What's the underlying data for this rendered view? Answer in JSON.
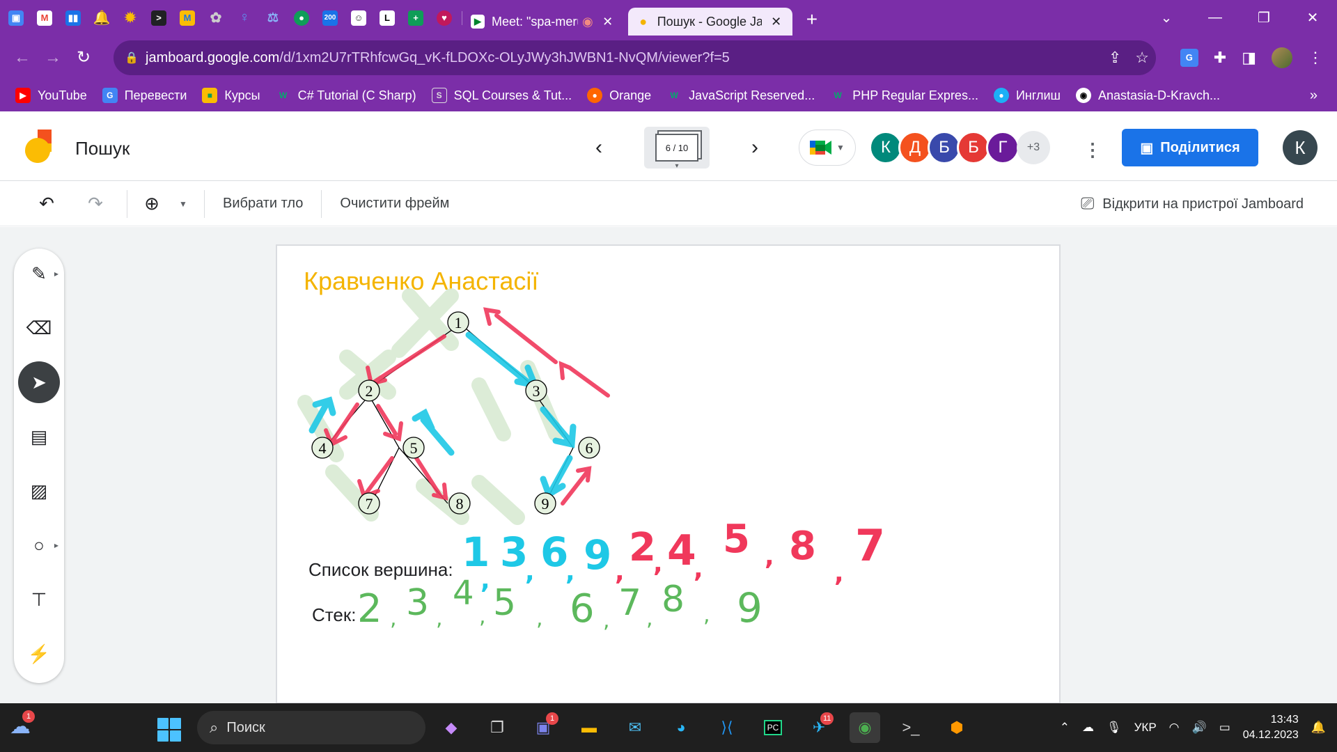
{
  "browser": {
    "tabs": [
      {
        "title": "Meet: \"spa-meru-u",
        "active": false
      },
      {
        "title": "Пошук - Google Jamboard",
        "active": true
      }
    ],
    "pinned_count": 16,
    "url_host": "jamboard.google.com",
    "url_path": "/d/1xm2U7rTRhfcwGq_vK-fLDOXc-OLyJWy3hJWBN1-NvQM/viewer?f=5",
    "bookmarks": [
      {
        "label": "YouTube",
        "icon": "youtube-icon",
        "color": "#ff0000"
      },
      {
        "label": "Перевести",
        "icon": "translate-icon",
        "color": "#4285f4"
      },
      {
        "label": "Курсы",
        "icon": "classroom-icon",
        "color": "#fbbc04"
      },
      {
        "label": "C# Tutorial (C Sharp)",
        "icon": "w3-icon",
        "color": "#04aa6d"
      },
      {
        "label": "SQL Courses & Tut...",
        "icon": "page-icon",
        "color": "#5f6368"
      },
      {
        "label": "Orange",
        "icon": "orange-icon",
        "color": "#ff6600"
      },
      {
        "label": "JavaScript Reserved...",
        "icon": "w3-icon",
        "color": "#04aa6d"
      },
      {
        "label": "PHP Regular Expres...",
        "icon": "w3-icon",
        "color": "#04aa6d"
      },
      {
        "label": "Инглиш",
        "icon": "duo-icon",
        "color": "#1cb0f6"
      },
      {
        "label": "Anastasia-D-Kravch...",
        "icon": "github-icon",
        "color": "#000000"
      }
    ],
    "bookmarks_more": "»"
  },
  "jamboard": {
    "title": "Пошук",
    "frame_indicator": "6 / 10",
    "collaborators": [
      {
        "initial": "К",
        "color": "#00897b"
      },
      {
        "initial": "Д",
        "color": "#f4511e"
      },
      {
        "initial": "Б",
        "color": "#3949ab"
      },
      {
        "initial": "Б",
        "color": "#e53935"
      },
      {
        "initial": "Г",
        "color": "#6a1b9a"
      }
    ],
    "collaborators_more": "+3",
    "share_label": "Поділитися",
    "user_initial": "К",
    "toolbar": {
      "background_label": "Вибрати тло",
      "clear_label": "Очистити фрейм",
      "open_device_label": "Відкрити на пристрої Jamboard"
    }
  },
  "frame": {
    "title": "Кравченко Анастасії",
    "title_color": "#f4b400",
    "list_label": "Список вершина:",
    "stack_label": "Стек:",
    "tree_nodes": [
      "1",
      "2",
      "3",
      "4",
      "5",
      "6",
      "7",
      "8",
      "9"
    ],
    "handwritten_list": [
      "1",
      "3",
      "6",
      "9",
      "2",
      "4",
      "5",
      "8",
      "7"
    ],
    "handwritten_stack": [
      "2",
      "3",
      "4",
      "5",
      "6",
      "7",
      "8",
      "9"
    ],
    "colors": {
      "blue": "#1ec8e6",
      "red": "#f0385b",
      "green": "#5cb85c",
      "highlight": "#d9ead3"
    }
  },
  "taskbar": {
    "search_placeholder": "Поиск",
    "weather_badge": "1",
    "teams_badge": "1",
    "telegram_badge": "11",
    "language": "УКР",
    "time": "13:43",
    "date": "04.12.2023"
  }
}
